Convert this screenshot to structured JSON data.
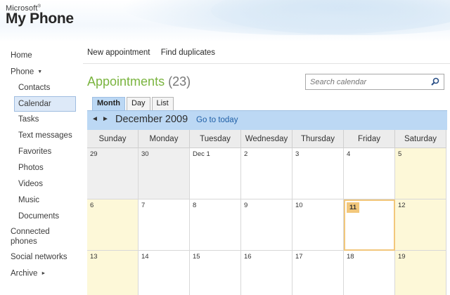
{
  "header": {
    "brand": "Microsoft",
    "trademark": "®",
    "product": "My Phone"
  },
  "sidebar": {
    "items": [
      {
        "label": "Home"
      },
      {
        "label": "Phone",
        "icon": "caret-down-icon"
      },
      {
        "label": "Contacts"
      },
      {
        "label": "Calendar",
        "selected": true
      },
      {
        "label": "Tasks"
      },
      {
        "label": "Text messages"
      },
      {
        "label": "Favorites"
      },
      {
        "label": "Photos"
      },
      {
        "label": "Videos"
      },
      {
        "label": "Music"
      },
      {
        "label": "Documents"
      },
      {
        "label_line1": "Connected",
        "label_line2": "phones"
      },
      {
        "label": "Social networks"
      },
      {
        "label": "Archive",
        "icon": "caret-right-icon"
      }
    ]
  },
  "actions": {
    "new_appointment": "New appointment",
    "find_duplicates": "Find duplicates"
  },
  "page": {
    "title": "Appointments",
    "count": "(23)",
    "title_color": "#7ab43f"
  },
  "search": {
    "placeholder": "Search calendar",
    "icon": "magnifier-icon"
  },
  "tabs": [
    {
      "label": "Month",
      "active": true
    },
    {
      "label": "Day"
    },
    {
      "label": "List"
    }
  ],
  "monthbar": {
    "prev_arrow": "◄",
    "next_arrow": "►",
    "month": "December 2009",
    "goto_today": "Go to today",
    "bar_color": "#bcd8f4"
  },
  "calendar": {
    "weekdays": [
      "Sunday",
      "Monday",
      "Tuesday",
      "Wednesday",
      "Thursday",
      "Friday",
      "Saturday"
    ],
    "weeks": [
      [
        "29",
        "30",
        "Dec 1",
        "2",
        "3",
        "4",
        "5"
      ],
      [
        "6",
        "7",
        "8",
        "9",
        "10",
        "11",
        "12"
      ],
      [
        "13",
        "14",
        "15",
        "16",
        "17",
        "18",
        "19"
      ]
    ],
    "today": "11",
    "today_color": "#f2c77b",
    "weekend_color": "#fdf8d8"
  }
}
